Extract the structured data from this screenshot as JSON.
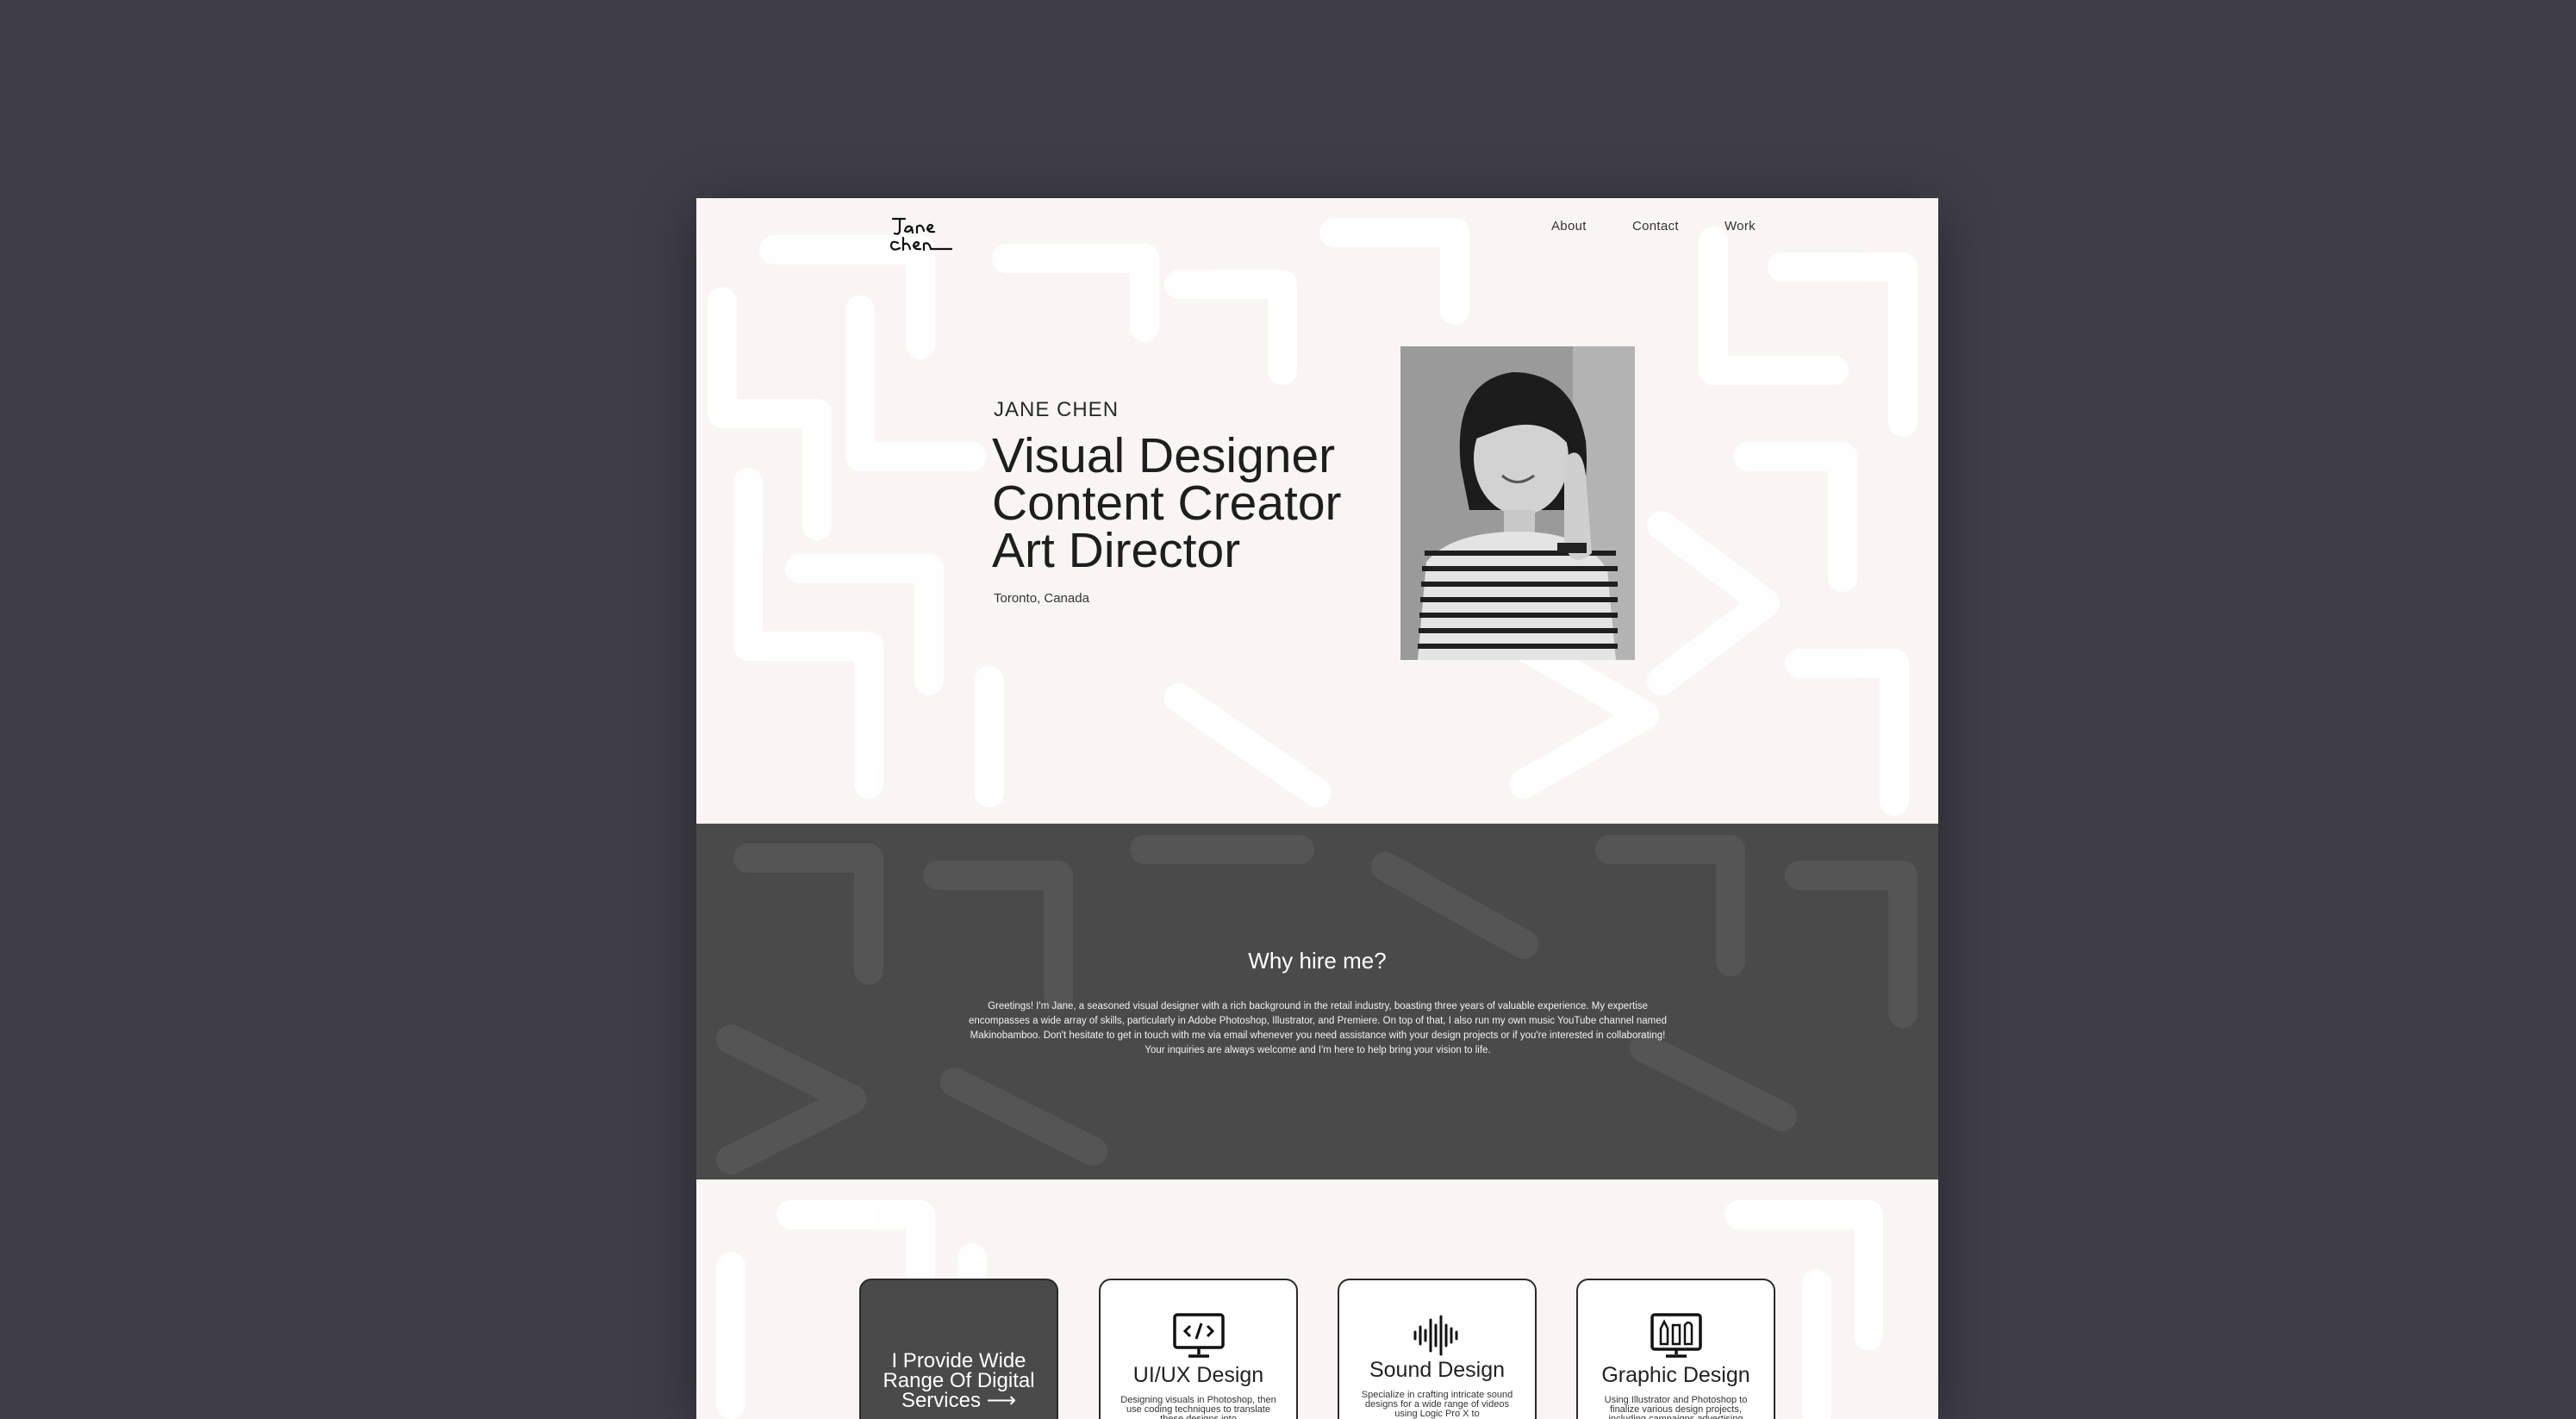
{
  "nav": {
    "logo_alt": "Jane Chen",
    "links": [
      "About",
      "Contact",
      "Work"
    ]
  },
  "hero": {
    "eyebrow": "JANE CHEN",
    "title_lines": [
      "Visual Designer",
      "Content Creator",
      "Art Director"
    ],
    "location": "Toronto, Canada"
  },
  "why": {
    "title": "Why hire me?",
    "body": "Greetings! I'm Jane, a seasoned visual designer with a rich background in the retail industry, boasting three years of valuable experience. My expertise encompasses a wide array of skills, particularly in Adobe Photoshop, Illustrator, and Premiere. On top of that, I also run my own music YouTube channel named Makinobamboo. Don't hesitate to get in touch with me via email whenever you need assistance with your design projects or if you're interested in collaborating! Your inquiries are always welcome and I'm here to help bring your vision to life."
  },
  "services": {
    "lead": "I Provide Wide Range Of Digital Services ⟶",
    "cards": [
      {
        "title": "UI/UX Design",
        "icon": "code-monitor-icon",
        "desc": "Designing visuals in Photoshop, then use coding techniques to translate these designs into"
      },
      {
        "title": "Sound Design",
        "icon": "sound-wave-icon",
        "desc": "Specialize in crafting intricate sound designs for a wide range of videos using Logic Pro X to"
      },
      {
        "title": "Graphic Design",
        "icon": "design-tools-icon",
        "desc": "Using Illustrator and Photoshop to finalize various design projects, including campaigns advertising"
      }
    ]
  },
  "colors": {
    "outer_bg": "#3f3d46",
    "page_bg": "#f8f6f2",
    "dark_band": "#4a4a4a",
    "text_dark": "#1e1e1e"
  }
}
